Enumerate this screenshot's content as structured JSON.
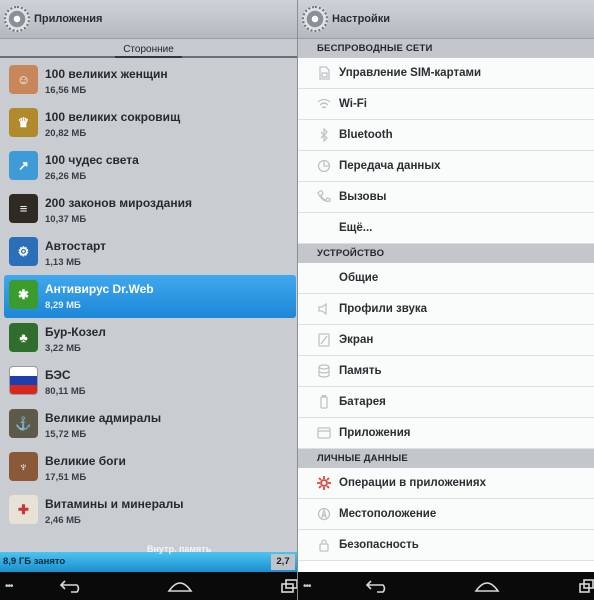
{
  "left": {
    "title": "Приложения",
    "tab_label": "Сторонние",
    "apps": [
      {
        "name": "100 великих женщин",
        "size": "16,56 МБ",
        "icon": "portrait-icon",
        "color": "#c8875a",
        "glyph": "☺"
      },
      {
        "name": "100 великих сокровищ",
        "size": "20,82 МБ",
        "icon": "pharaoh-mask-icon",
        "color": "#b08a2c",
        "glyph": "♛"
      },
      {
        "name": "100 чудес света",
        "size": "26,26 МБ",
        "icon": "chart-arrow-icon",
        "color": "#3f9ad8",
        "glyph": "↗"
      },
      {
        "name": "200 законов мироздания",
        "size": "10,37 МБ",
        "icon": "book-cover-icon",
        "color": "#2f2a22",
        "glyph": "≡"
      },
      {
        "name": "Автостарт",
        "size": "1,13 МБ",
        "icon": "gear-blue-icon",
        "color": "#2b6fb8",
        "glyph": "⚙"
      },
      {
        "name": "Антивирус Dr.Web",
        "size": "8,29 МБ",
        "icon": "spider-icon",
        "color": "#3c9b2d",
        "glyph": "✱",
        "selected": true
      },
      {
        "name": "Бур-Козел",
        "size": "3,22 МБ",
        "icon": "playing-cards-icon",
        "color": "#2f6e2c",
        "glyph": "♣"
      },
      {
        "name": "БЭС",
        "size": "80,11 МБ",
        "icon": "russian-flag-icon",
        "color": "#d22",
        "glyph": ""
      },
      {
        "name": "Великие адмиралы",
        "size": "15,72 МБ",
        "icon": "admiral-icon",
        "color": "#5d5a4a",
        "glyph": "⚓"
      },
      {
        "name": "Великие боги",
        "size": "17,51 МБ",
        "icon": "god-statue-icon",
        "color": "#8a5a38",
        "glyph": "♆"
      },
      {
        "name": "Витамины и минералы",
        "size": "2,46 МБ",
        "icon": "vitamins-icon",
        "color": "#e8e2d6",
        "glyph": "✚"
      }
    ],
    "storage": {
      "label": "Внутр. память",
      "used": "8,9 ГБ занято",
      "free": "2,7"
    }
  },
  "right": {
    "title": "Настройки",
    "sections": [
      {
        "header": "БЕСПРОВОДНЫЕ СЕТИ",
        "items": [
          {
            "label": "Управление SIM-картами",
            "icon": "sim-card-icon"
          },
          {
            "label": "Wi-Fi",
            "icon": "wifi-icon"
          },
          {
            "label": "Bluetooth",
            "icon": "bluetooth-icon"
          },
          {
            "label": "Передача данных",
            "icon": "data-usage-icon"
          },
          {
            "label": "Вызовы",
            "icon": "phone-icon"
          },
          {
            "label": "Ещё...",
            "icon": ""
          }
        ]
      },
      {
        "header": "УСТРОЙСТВО",
        "items": [
          {
            "label": "Общие",
            "icon": ""
          },
          {
            "label": "Профили звука",
            "icon": "sound-profile-icon"
          },
          {
            "label": "Экран",
            "icon": "display-icon"
          },
          {
            "label": "Память",
            "icon": "storage-icon"
          },
          {
            "label": "Батарея",
            "icon": "battery-icon"
          },
          {
            "label": "Приложения",
            "icon": "apps-icon"
          }
        ]
      },
      {
        "header": "ЛИЧНЫЕ ДАННЫЕ",
        "items": [
          {
            "label": "Операции в приложениях",
            "icon": "app-ops-icon"
          },
          {
            "label": "Местоположение",
            "icon": "location-icon"
          },
          {
            "label": "Безопасность",
            "icon": "lock-icon"
          }
        ]
      }
    ]
  },
  "navbar": {
    "icons": [
      "menu-dots-icon",
      "back-icon",
      "home-icon",
      "recent-apps-icon"
    ]
  }
}
